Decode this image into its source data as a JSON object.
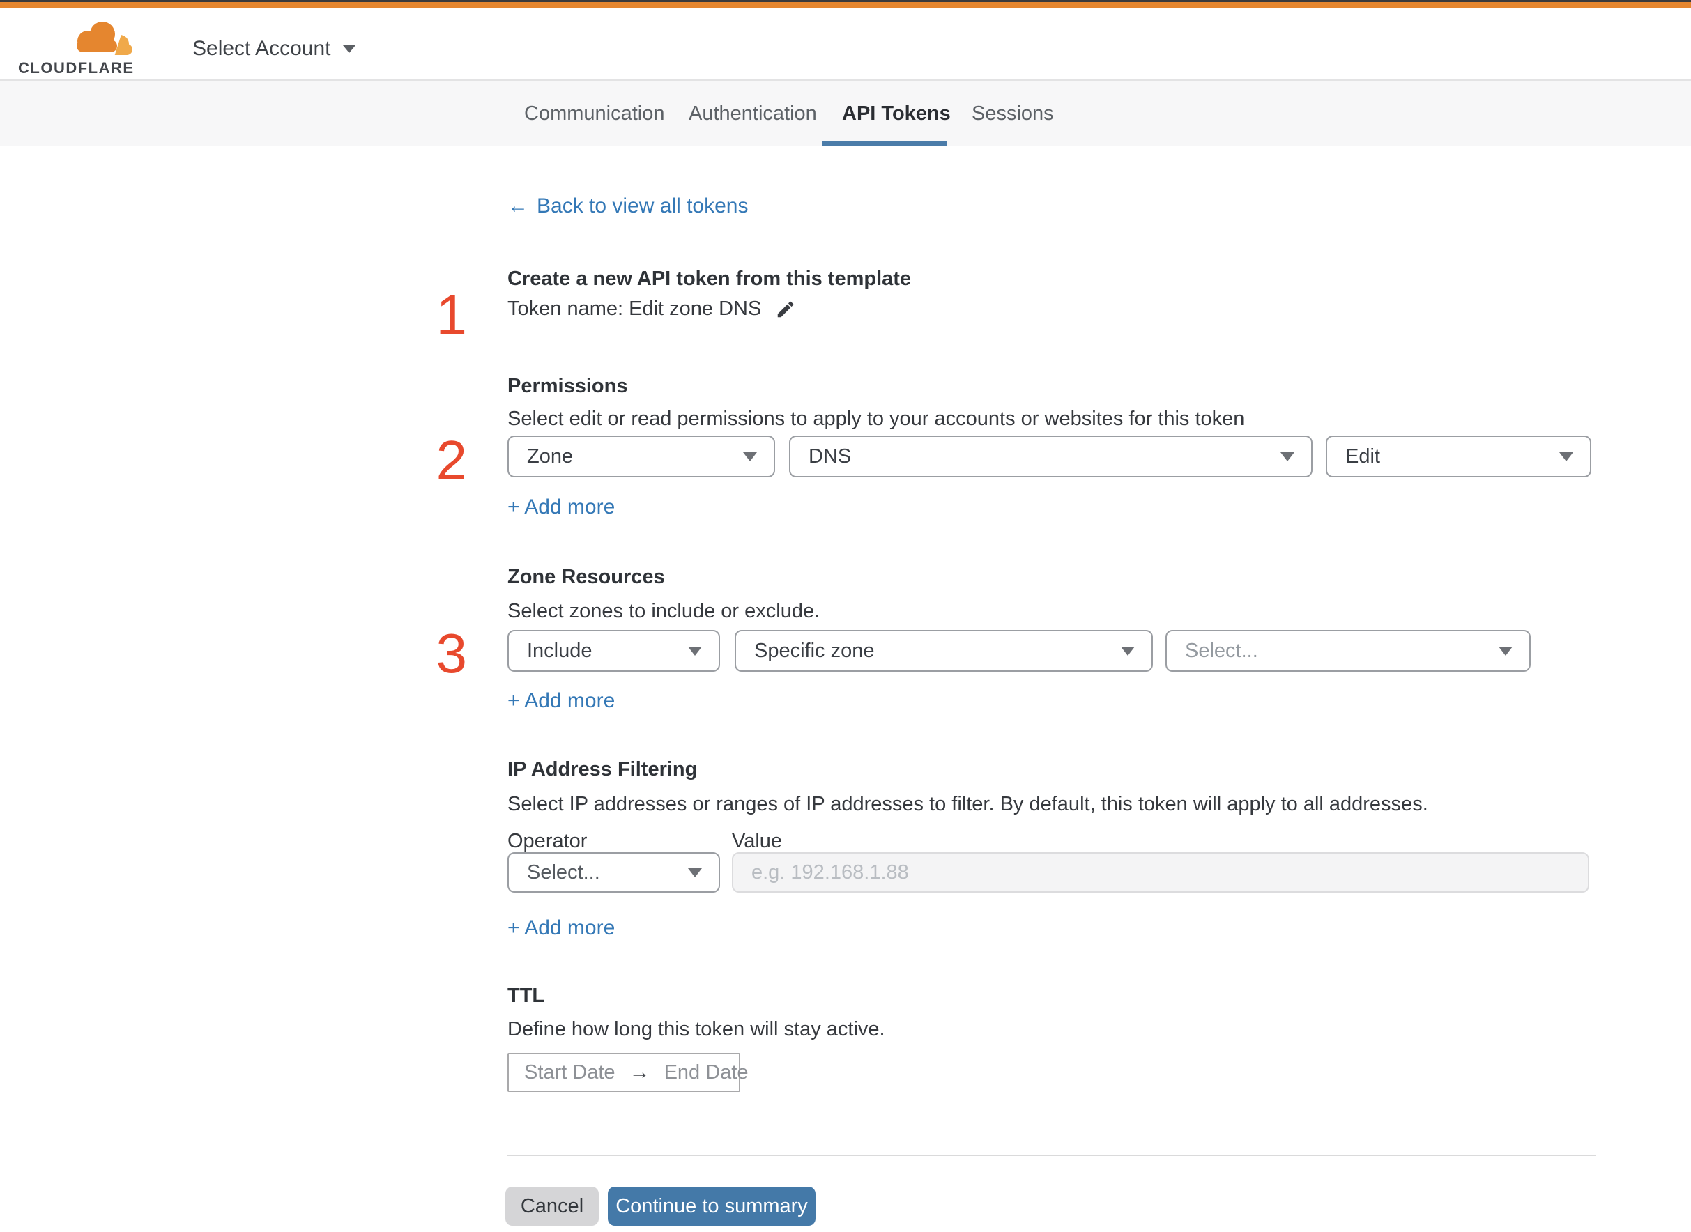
{
  "colors": {
    "top_bar_orange": "#e5862f",
    "brand_orange": "#e5862f",
    "brand_orange_light": "#f0a94a",
    "link_blue": "#3478b6",
    "tab_active_underline_blue": "#4b7ca9",
    "continue_button_blue": "#4479a8",
    "cancel_button_gray": "#d5d5d7",
    "step_marker_red": "#e8492d"
  },
  "icons": {
    "back_arrow_glyph": "←",
    "range_arrow_glyph": "→"
  },
  "header": {
    "brand": "CLOUDFLARE",
    "account_selector": "Select Account"
  },
  "tabs": [
    {
      "label": "Communication",
      "active": false
    },
    {
      "label": "Authentication",
      "active": false
    },
    {
      "label": "API Tokens",
      "active": true
    },
    {
      "label": "Sessions",
      "active": false
    }
  ],
  "back_link": {
    "label": "Back to view all tokens"
  },
  "template_section": {
    "step": "1",
    "title": "Create a new API token from this template",
    "token_name": "Token name: Edit zone DNS"
  },
  "permissions": {
    "step": "2",
    "heading": "Permissions",
    "description": "Select edit or read permissions to apply to your accounts or websites for this token",
    "scope": "Zone",
    "resource": "DNS",
    "access": "Edit",
    "add_more": "+ Add more"
  },
  "zone_resources": {
    "step": "3",
    "heading": "Zone Resources",
    "description": "Select zones to include or exclude.",
    "operator": "Include",
    "scope": "Specific zone",
    "zone_placeholder": "Select...",
    "add_more": "+ Add more"
  },
  "ip_filtering": {
    "heading": "IP Address Filtering",
    "description": "Select IP addresses or ranges of IP addresses to filter. By default, this token will apply to all addresses.",
    "operator_label": "Operator",
    "value_label": "Value",
    "operator_placeholder": "Select...",
    "value_placeholder": "e.g. 192.168.1.88",
    "add_more": "+ Add more"
  },
  "ttl": {
    "heading": "TTL",
    "description": "Define how long this token will stay active.",
    "start_date_placeholder": "Start Date",
    "end_date_placeholder": "End Date"
  },
  "footer": {
    "cancel_label": "Cancel",
    "continue_label": "Continue to summary"
  }
}
